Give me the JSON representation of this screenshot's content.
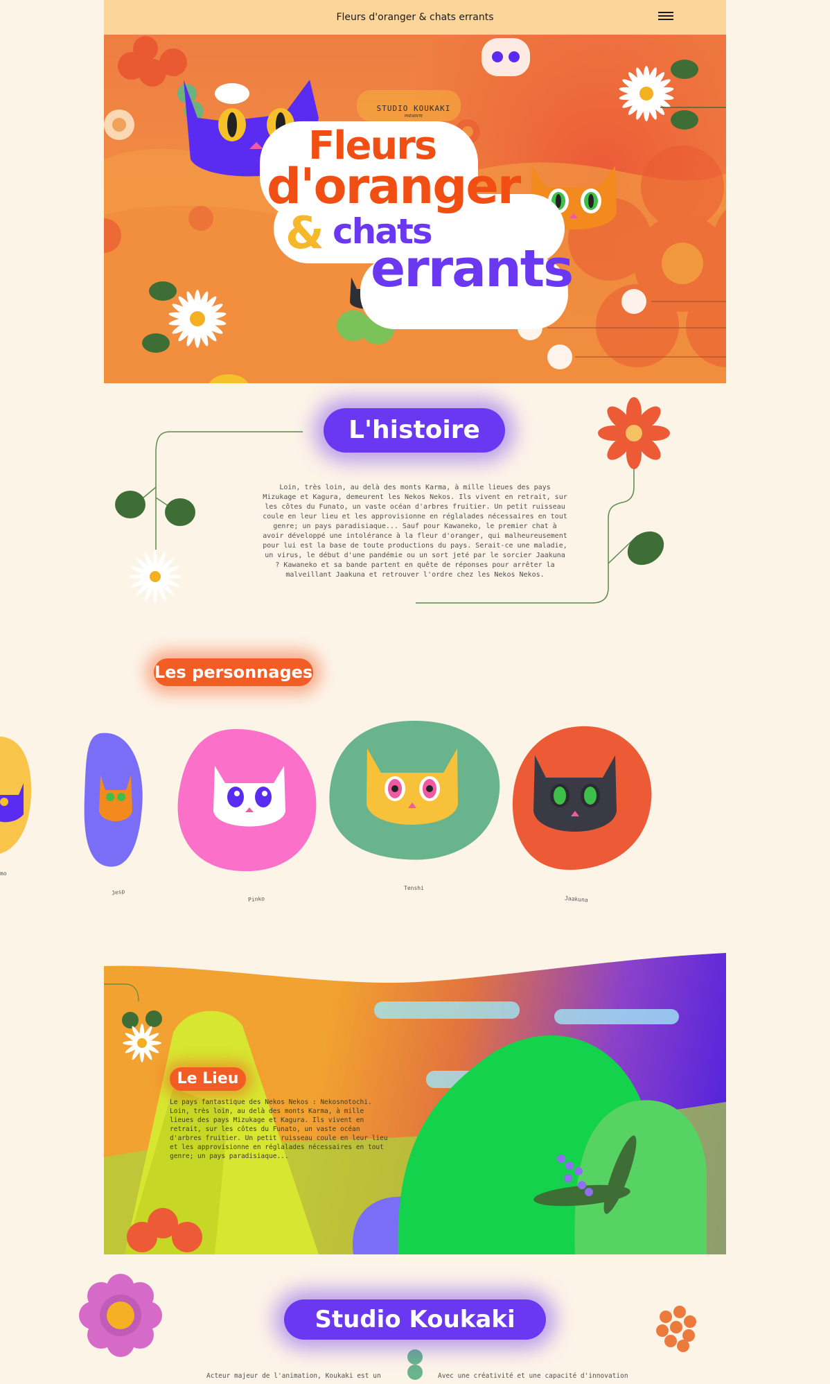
{
  "header": {
    "title": "Fleurs d'oranger & chats errants",
    "menu_icon": "hamburger-menu-icon"
  },
  "hero": {
    "studio": "STUDIO KOUKAKI",
    "presents": "PRÉSENTE",
    "logo_line1": "Fleurs",
    "logo_line2": "d'oranger",
    "logo_amp": "&",
    "logo_line3": "chats",
    "logo_line4": "errants"
  },
  "story": {
    "heading": "L'histoire",
    "text": "Loin, très loin, au delà des monts Karma, à mille lieues des pays Mizukage et Kagura, demeurent les Nekos Nekos. Ils vivent en retrait, sur les côtes du Funato, un vaste océan d'arbres fruitier. Un petit ruisseau coule en leur lieu et les approvisionne en réglalades nécessaires en tout genre; un pays paradisiaque... Sauf pour Kawaneko, le premier chat à avoir développé une intolérance à la fleur d'oranger, qui malheureusement pour lui est la base de toute productions du pays. Serait-ce une maladie, un virus, le début d'une pandémie ou un sort jeté par le sorcier Jaakuna ? Kawaneko et sa bande partent en quête de réponses pour arrêter la malveillant Jaakuna et retrouver l'ordre chez les Nekos Nekos."
  },
  "characters": {
    "heading": "Les personnages",
    "items": [
      {
        "name": "mo",
        "color": "#f9c44a"
      },
      {
        "name": "Jesp",
        "color": "#7b6ef6"
      },
      {
        "name": "Pinko",
        "color": "#fb70c8"
      },
      {
        "name": "Tenshi",
        "color": "#69b48c"
      },
      {
        "name": "Jaakuna",
        "color": "#ec5a36"
      }
    ]
  },
  "place": {
    "heading": "Le Lieu",
    "text": "Le pays fantastique des Nekos Nekos : Nekosnotochi. Loin, très loin, au delà des monts Karma, à mille lieues des pays Mizukage et Kagura. Ils vivent en retrait, sur les côtes du Funato, un vaste océan d'arbres fruitier. Un petit ruisseau coule en leur lieu et les approvisionne en réglalades nécessaires en tout genre; un pays paradisiaque..."
  },
  "studio": {
    "heading": "Studio Koukaki",
    "col1": "Acteur majeur de l'animation, Koukaki est un",
    "col2": "Avec une créativité et une capacité d'innovation"
  },
  "colors": {
    "topbar": "#fcd59b",
    "background": "#fdf4e8",
    "orange": "#ee7d42",
    "purple": "#6a38f0",
    "red_orange": "#ec5a36"
  }
}
